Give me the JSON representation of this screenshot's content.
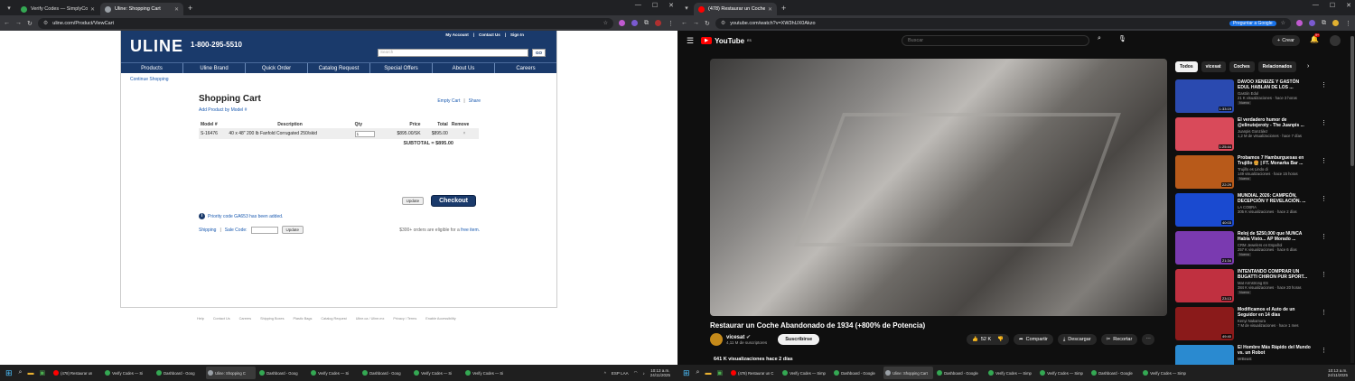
{
  "left": {
    "tabs": [
      {
        "title": "Verify Codes — SimplyCodes",
        "color": "#34a853"
      },
      {
        "title": "Uline: Shopping Cart",
        "color": "#9aa0a6"
      }
    ],
    "url": "uline.com/Product/ViewCart",
    "uline": {
      "logo": "ULINE",
      "phone": "1-800-295-5510",
      "toplinks": [
        "My Account",
        "Contact Us",
        "Sign In"
      ],
      "search_placeholder": "Search",
      "go": "GO",
      "nav": [
        "Products",
        "Uline Brand",
        "Quick Order",
        "Catalog Request",
        "Special Offers",
        "About Us",
        "Careers"
      ],
      "continue": "Continue Shopping",
      "cart_title": "Shopping Cart",
      "empty_cart": "Empty Cart",
      "share": "Share",
      "add_by_model": "Add Product by Model #",
      "columns": [
        "Model #",
        "Description",
        "Qty",
        "Price",
        "Total",
        "Remove"
      ],
      "row": {
        "model": "S-16476",
        "description": "40 x 48\" 200 lb Fanfold Corrugated 250/skid",
        "qty": "1",
        "price": "$895.00/SK",
        "total": "$895.00",
        "remove": "×"
      },
      "subtotal_label": "SUBTOTAL =",
      "subtotal": "$895.00",
      "update": "Update",
      "checkout": "Checkout",
      "info": "Priority code GA653 has been added.",
      "shipping": "Shipping",
      "sale_code": "Sale Code:",
      "update2": "Update",
      "free_text": "$300+ orders are eligible for a",
      "free_link": "free item.",
      "footer": [
        "Help",
        "Contact Us",
        "Careers",
        "Shipping Boxes",
        "Plastic Bags",
        "Catalog Request",
        "Uline.ca / Uline.mx",
        "Privacy / Terms",
        "Enable Accessibility"
      ]
    }
  },
  "right": {
    "tabs": [
      {
        "title": "(478) Restaurar un Coche A",
        "color": "#ff0000"
      }
    ],
    "url": "youtube.com/watch?v=XW3hUX0Akzo",
    "translate": "Preguntar a Google",
    "yt": {
      "logo": "YouTube",
      "country": "ES",
      "search_placeholder": "Buscar",
      "create": "Crear",
      "notif_count": "9+",
      "video_title": "Restaurar un Coche Abandonado de 1934 (+800% de Potencia)",
      "channel": "vicesat",
      "subs": "4,11 M de suscriptores",
      "subscribe": "Suscribirse",
      "likes": "52 K",
      "share": "Compartir",
      "download": "Descargar",
      "clip": "Recortar",
      "views_line": "641 K visualizaciones  hace 2 días",
      "chips": [
        "Todos",
        "vicesat",
        "Coches",
        "Relacionados"
      ],
      "recs": [
        {
          "title": "DAVOO XENEIZE Y GASTÓN EDUL HABLAN DE LOS ...",
          "channel": "Gastón Edul",
          "views": "21 K visualizaciones · hace 3 horas",
          "dur": "1:33:19",
          "color": "#2a4ab0",
          "badge": "Nuevo"
        },
        {
          "title": "El verdadero humor de @elinutejeroty - The Juanpis ...",
          "channel": "Juanpis González",
          "views": "1,2 M de visualizaciones · hace 7 días",
          "dur": "1:25:44",
          "color": "#d94a5a",
          "badge": ""
        },
        {
          "title": "Probamos 7 Hamburguesas en Trujillo 🍔 | FT. Monarka Bar ...",
          "channel": "Trujillo es Lindo di",
          "views": "149 visualizaciones · hace 15 horas",
          "dur": "22:29",
          "color": "#b85a1a",
          "badge": "Nuevo"
        },
        {
          "title": "MUNDIAL 2026: CAMPEÓN, DECEPCIÓN Y REVELACIÓN. ...",
          "channel": "LA COBRA",
          "views": "305 K visualizaciones · hace 2 días",
          "dur": "40:03",
          "color": "#1a4ad0",
          "badge": ""
        },
        {
          "title": "Reloj de $250,000 que NUNCA Había Visto... AP Morado ...",
          "channel": "CRM Jewelers en Español",
          "views": "257 K visualizaciones · hace 6 días",
          "dur": "21:34",
          "color": "#7a3ab0",
          "badge": "Nuevo"
        },
        {
          "title": "INTENTANDO COMPRAR UN BUGATTI CHIRON PUR SPORT...",
          "channel": "Mat Armstrong ES",
          "views": "384 K visualizaciones · hace 20 horas",
          "dur": "23:13",
          "color": "#c03040",
          "badge": "Nuevo"
        },
        {
          "title": "Modificamos el Auto de un Seguidor en 14 días",
          "channel": "Kenyi Nakamura",
          "views": "7 M de visualizaciones · hace 1 mes",
          "dur": "49:40",
          "color": "#8a1a1a",
          "badge": ""
        },
        {
          "title": "El Hombre Más Rápido del Mundo vs. un Robot",
          "channel": "MrBeast",
          "views": "",
          "dur": "",
          "color": "#2a8ad0",
          "badge": ""
        }
      ]
    }
  },
  "taskbar_left": {
    "items": [
      {
        "label": "(478) Restaurar un",
        "color": "#ff0000"
      },
      {
        "label": "Verify Codes — Si",
        "color": "#34a853"
      },
      {
        "label": "Dashboard - Goog",
        "color": "#34a853"
      },
      {
        "label": "Uline: Shopping C",
        "color": "#9aa0a6"
      },
      {
        "label": "Dashboard - Goog",
        "color": "#34a853"
      },
      {
        "label": "Verify Codes — Si",
        "color": "#34a853"
      },
      {
        "label": "Dashboard - Goog",
        "color": "#34a853"
      },
      {
        "label": "Verify Codes — Si",
        "color": "#34a853"
      },
      {
        "label": "Verify Codes — Si",
        "color": "#34a853"
      }
    ],
    "lang": "ESP LAA",
    "time": "10:13 a.m.",
    "date": "24/11/2025"
  },
  "taskbar_right": {
    "items": [
      {
        "label": "(478) Restaurar un C",
        "color": "#ff0000"
      },
      {
        "label": "Verify Codes — Simp",
        "color": "#34a853"
      },
      {
        "label": "Dashboard - Google",
        "color": "#34a853"
      },
      {
        "label": "Uline: Shopping Cart",
        "color": "#9aa0a6"
      },
      {
        "label": "Dashboard - Google",
        "color": "#34a853"
      },
      {
        "label": "Verify Codes — Simp",
        "color": "#34a853"
      },
      {
        "label": "Verify Codes — Simp",
        "color": "#34a853"
      },
      {
        "label": "Dashboard - Google",
        "color": "#34a853"
      },
      {
        "label": "Verify Codes — Simp",
        "color": "#34a853"
      }
    ],
    "time": "10:13 a.m.",
    "date": "24/11/2025"
  }
}
